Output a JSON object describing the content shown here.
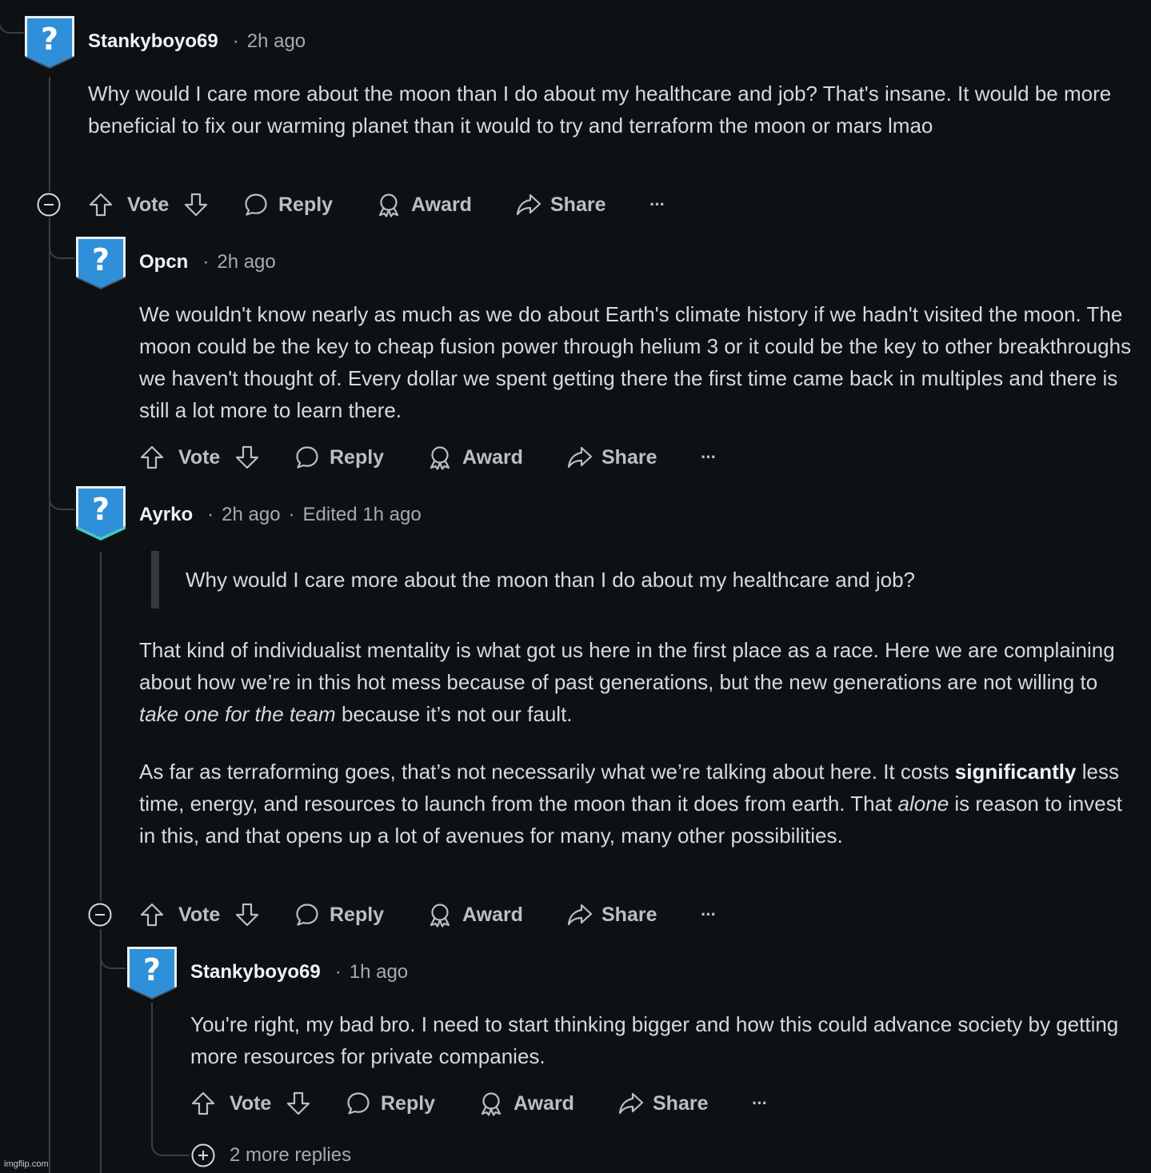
{
  "comments": [
    {
      "author": "Stankyboyo69",
      "time": "2h ago",
      "paragraphs": [
        "Why would I care more about the moon than I do about my healthcare and job? That's insane. It would be more beneficial to fix our warming planet than it would to try and terraform the moon or mars lmao"
      ]
    },
    {
      "author": "Opcn",
      "time": "2h ago",
      "paragraphs": [
        "We wouldn't know nearly as much as we do about Earth's climate history if we hadn't visited the moon. The moon could be the key to cheap fusion power through helium 3 or it could be the key to other breakthroughs we haven't thought of. Every dollar we spent getting there the first time came back in multiples and there is still a lot more to learn there."
      ]
    },
    {
      "author": "Ayrko",
      "time": "2h ago",
      "edited": "Edited 1h ago",
      "quote": "Why would I care more about the moon than I do about my healthcare and job?",
      "p1": {
        "a": "That kind of individualist mentality is what got us here in the first place as a race. Here we are complaining about how we’re in this hot mess because of past generations, but the new generations are not willing to ",
        "em": "take one for the team",
        "b": " because it’s not our fault."
      },
      "p2": {
        "a": "As far as terraforming goes, that’s not necessarily what we’re talking about here. It costs ",
        "strong": "significantly",
        "b": " less time, energy, and resources to launch from the moon than it does from earth. That ",
        "em": "alone",
        "c": " is reason to invest in this, and that opens up a lot of avenues for many, many other possibilities."
      }
    },
    {
      "author": "Stankyboyo69",
      "time": "1h ago",
      "paragraphs": [
        "You're right, my bad bro. I need to start thinking bigger and how this could advance society by getting more resources for private companies."
      ]
    }
  ],
  "actions": {
    "vote": "Vote",
    "reply": "Reply",
    "award": "Award",
    "share": "Share",
    "more": "···"
  },
  "more_replies": "2 more replies",
  "watermark": "imgflip.com",
  "icons": [
    "avatar-icon",
    "collapse-icon",
    "upvote-icon",
    "downvote-icon",
    "reply-icon",
    "award-icon",
    "share-icon",
    "more-icon",
    "expand-icon"
  ],
  "colors": {
    "background": "#0e1113",
    "text": "#d7dadc",
    "dim": "#a3abb3",
    "avatar": "#2f8fd8"
  }
}
